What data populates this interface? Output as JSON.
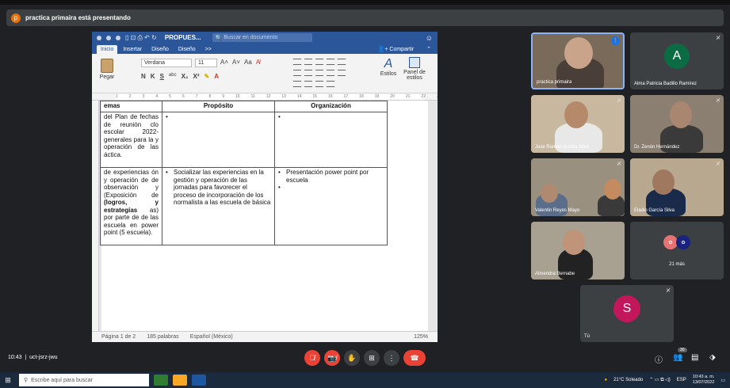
{
  "banner": {
    "text": "practica primaira está presentando",
    "initial": "p"
  },
  "word": {
    "doc_name": "PROPUES...",
    "search_placeholder": "Buscar en documento",
    "tabs": [
      "Inicio",
      "Insertar",
      "Diseño",
      "Diseño",
      ">>"
    ],
    "share": "Compartir",
    "paste": "Pegar",
    "font": "Verdana",
    "size": "11",
    "format_buttons": [
      "N",
      "K",
      "S",
      "abc",
      "X₂",
      "X²"
    ],
    "styles": "Estilos",
    "styles_panel": "Panel de estilos",
    "ruler": [
      "1",
      "2",
      "3",
      "4",
      "5",
      "6",
      "7",
      "8",
      "9",
      "10",
      "11",
      "12",
      "13",
      "14",
      "15",
      "16",
      "17",
      "18",
      "19",
      "20",
      "21",
      "22",
      "23",
      "24",
      "25",
      "26"
    ],
    "table": {
      "headers": [
        "emas",
        "Propósito",
        "Organización"
      ],
      "rows": [
        {
          "c1": "del Plan de fechas de reunión clo escolar 2022- generales para la y operación de las áctica.",
          "c2": [
            ""
          ],
          "c3": [
            ""
          ]
        },
        {
          "c1_a": "de experiencias ón y operación de de observación y (Exposición de",
          "c1_bold": "(logros, y estrategias",
          "c1_b": "as) por parte de de las escuela en power point (5 escuela).",
          "c2": [
            "Socializar las experiencias en la gestión y operación de las jornadas para favorecer el proceso de incorporación de los normalista a las escuela de básica"
          ],
          "c3": [
            "Presentación power point por escuela",
            ""
          ]
        }
      ]
    },
    "status": {
      "page": "Página 1 de 2",
      "words": "185 palabras",
      "lang": "Español (México)",
      "zoom": "125%"
    }
  },
  "participants": [
    {
      "name": "practica primaira"
    },
    {
      "name": "Alma Patricia Badillo Ramirez",
      "initial": "A",
      "color": "#0b6b43"
    },
    {
      "name": "Jose Ramon Acosta Silva"
    },
    {
      "name": "Dr. Zenón Hernández"
    },
    {
      "name": "Valentin Reyes Mayo"
    },
    {
      "name": "Eladio García Silva"
    },
    {
      "name": "Almendra Bernabe"
    },
    {
      "name": "21 más"
    },
    {
      "name": "Tú",
      "initial": "S",
      "color": "#c2185b"
    }
  ],
  "meeting": {
    "time": "10:43",
    "code": "uct-jsrz-jwu",
    "people_count": "30"
  },
  "taskbar": {
    "search": "Escribe aquí para buscar",
    "weather": "21°C Soleado",
    "lang": "ESP",
    "time": "10:43 a. m.",
    "date": "13/07/2022"
  }
}
